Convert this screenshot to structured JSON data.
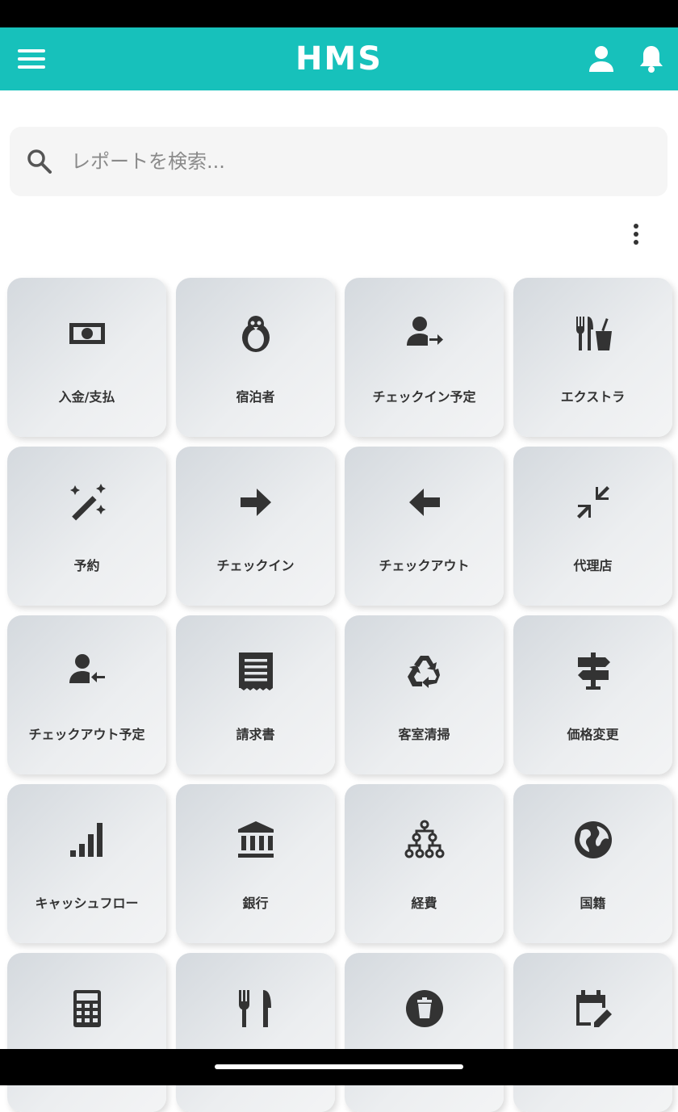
{
  "app_bar": {
    "title": "HMS",
    "background": "#17c1bb",
    "icons": [
      "menu-icon",
      "account-icon",
      "bell-icon"
    ]
  },
  "search": {
    "placeholder": "レポートを検索...",
    "value": ""
  },
  "tiles": [
    {
      "label": "入金/支払",
      "icon": "cash-icon"
    },
    {
      "label": "宿泊者",
      "icon": "penguin-icon"
    },
    {
      "label": "チェックイン予定",
      "icon": "person-arrow-right-icon"
    },
    {
      "label": "エクストラ",
      "icon": "food-drink-icon"
    },
    {
      "label": "予約",
      "icon": "magic-wand-icon"
    },
    {
      "label": "チェックイン",
      "icon": "arrow-right-icon"
    },
    {
      "label": "チェックアウト",
      "icon": "arrow-left-icon"
    },
    {
      "label": "代理店",
      "icon": "arrows-collapse-icon"
    },
    {
      "label": "チェックアウト予定",
      "icon": "person-arrow-left-icon"
    },
    {
      "label": "請求書",
      "icon": "receipt-icon"
    },
    {
      "label": "客室清掃",
      "icon": "recycle-icon"
    },
    {
      "label": "価格変更",
      "icon": "signpost-icon"
    },
    {
      "label": "キャッシュフロー",
      "icon": "signal-bars-icon"
    },
    {
      "label": "銀行",
      "icon": "bank-icon"
    },
    {
      "label": "経費",
      "icon": "hierarchy-icon"
    },
    {
      "label": "国籍",
      "icon": "globe-icon"
    },
    {
      "label": "",
      "icon": "calculator-icon"
    },
    {
      "label": "",
      "icon": "silverware-icon"
    },
    {
      "label": "",
      "icon": "trash-circle-icon"
    },
    {
      "label": "",
      "icon": "calendar-edit-icon"
    }
  ]
}
